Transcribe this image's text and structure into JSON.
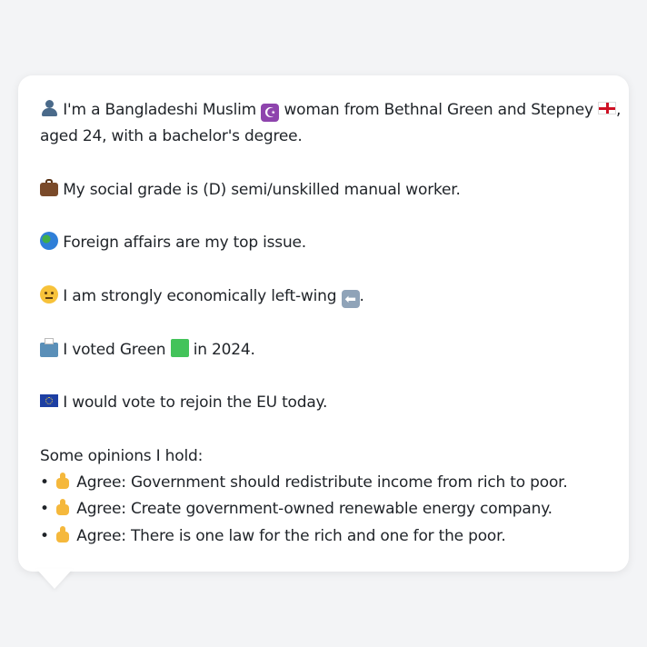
{
  "profile": {
    "line1_part1": "I'm a Bangladeshi Muslim",
    "line1_part2": "woman from Bethnal Green and Stepney",
    "line1_part3": ",",
    "line2": "aged 24, with a bachelor's degree.",
    "social_grade": "My social grade is (D) semi/unskilled manual worker.",
    "top_issue": "Foreign affairs are my top issue.",
    "economic": "I am strongly economically left-wing",
    "economic_end": ".",
    "voted_part1": "I voted Green",
    "voted_part2": "in 2024.",
    "eu": "I would vote to rejoin the EU today."
  },
  "opinions": {
    "heading": "Some opinions I hold:",
    "bullet": "•",
    "items": [
      "Agree: Government should redistribute income from rich to poor.",
      "Agree: Create government-owned renewable energy company.",
      "Agree: There is one law for the rich and one for the poor."
    ]
  },
  "icons": {
    "user": "user-icon",
    "crescent": "star-and-crescent-icon",
    "england_flag": "england-flag-icon",
    "briefcase": "briefcase-icon",
    "globe": "globe-icon",
    "thinking": "thinking-face-icon",
    "left_arrow": "left-arrow-icon",
    "ballot": "ballot-box-icon",
    "green_square": "green-square-icon",
    "eu_flag": "eu-flag-icon",
    "thumbs_up": "thumbs-up-icon"
  },
  "colors": {
    "background": "#f3f4f6",
    "bubble": "#ffffff",
    "text": "#1f2328"
  }
}
